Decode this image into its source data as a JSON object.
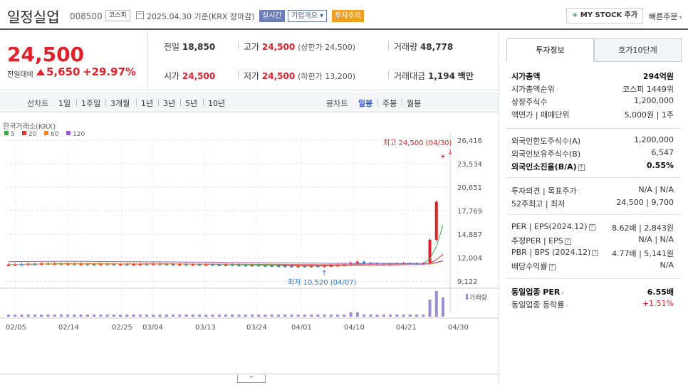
{
  "header": {
    "company": "일정실업",
    "code": "008500",
    "market": "코스피",
    "date_text": "2025.04.30 기준(KRX 장마감)",
    "realtime": "실시간",
    "overview": "기업개요",
    "caution": "투자주의",
    "mystock": "MY STOCK 추가",
    "mystock_plus": "+",
    "quick_order": "빠른주문"
  },
  "price": {
    "current": "24,500",
    "diff_label": "전일대비",
    "diff": "5,650",
    "rate": "+29.97%"
  },
  "quote": {
    "prev_label": "전일",
    "prev": "18,850",
    "high_label": "고가",
    "high": "24,500",
    "high_limit": "(상한가 24,500)",
    "volume_label": "거래량",
    "volume": "48,778",
    "open_label": "시가",
    "open": "24,500",
    "low_label": "저가",
    "low": "24,500",
    "low_limit": "(하한가 13,200)",
    "amount_label": "거래대금",
    "amount": "1,194",
    "amount_unit": "백만"
  },
  "periodbar": {
    "line_label": "선차트",
    "line_items": [
      "1일",
      "1주일",
      "3개월",
      "1년",
      "3년",
      "5년",
      "10년"
    ],
    "candle_label": "봉차트",
    "candle_items": [
      "일봉",
      "주봉",
      "월봉"
    ],
    "candle_active": "일봉"
  },
  "chart": {
    "source": "한국거래소(KRX)",
    "ma": [
      {
        "label": "5",
        "color": "#3aa84a"
      },
      {
        "label": "20",
        "color": "#e03030"
      },
      {
        "label": "60",
        "color": "#f08a20"
      },
      {
        "label": "120",
        "color": "#9a5ad0"
      }
    ],
    "high_note": "최고 24,500 (04/30)",
    "low_note": "최저 10,520 (04/07)",
    "y_ticks": [
      "26,416",
      "23,534",
      "20,651",
      "17,769",
      "14,887",
      "12,004",
      "9,122"
    ],
    "x_ticks": [
      "02/05",
      "02/14",
      "02/25",
      "03/04",
      "03/13",
      "03/24",
      "04/01",
      "04/10",
      "04/21",
      "04/30"
    ],
    "volume_label": "거래량",
    "up_color": "#e0202a",
    "down_color": "#2a7ad7"
  },
  "chart_data": {
    "type": "candlestick",
    "y_range": [
      9122,
      26416
    ],
    "x_ticks": [
      "02/05",
      "02/14",
      "02/25",
      "03/04",
      "03/13",
      "03/24",
      "04/01",
      "04/10",
      "04/21",
      "04/30"
    ],
    "annotations": [
      "최고 24,500 (04/30)",
      "최저 10,520 (04/07)"
    ],
    "close": [
      11150,
      11200,
      11180,
      11250,
      11220,
      11300,
      11260,
      11280,
      11230,
      11270,
      11240,
      11260,
      11220,
      11200,
      11250,
      11230,
      11190,
      11210,
      11180,
      11200,
      11240,
      11220,
      11260,
      11230,
      11210,
      11190,
      11200,
      11170,
      11190,
      11160,
      11180,
      11150,
      11130,
      11160,
      11120,
      11100,
      11080,
      11110,
      11070,
      11050,
      11020,
      11000,
      10980,
      10950,
      10980,
      10960,
      11000,
      10980,
      11020,
      11050,
      11100,
      11150,
      11350,
      11500,
      11300,
      11250,
      11200,
      11180,
      11230,
      11280,
      11320,
      11260,
      11250,
      11300,
      14200,
      18850,
      24500
    ],
    "volume_level": [
      1,
      1,
      1,
      1,
      1,
      1,
      1,
      1,
      1,
      1,
      1,
      1,
      1,
      1,
      1,
      1,
      1,
      1,
      1,
      1,
      1,
      1,
      1,
      1,
      1,
      1,
      1,
      1,
      1,
      1,
      1,
      1,
      1,
      1,
      1,
      1,
      1,
      1,
      1,
      1,
      1,
      1,
      1,
      1,
      1,
      1,
      1,
      1,
      1,
      1,
      1,
      1,
      2,
      2,
      1,
      1,
      1,
      1,
      1,
      1,
      1,
      1,
      1,
      1,
      8,
      12,
      9
    ]
  },
  "panel": {
    "tab_active": "투자정보",
    "tab_inactive": "호가10단계",
    "rows1": [
      {
        "k": "시가총액",
        "v": "294억원",
        "bold": true
      },
      {
        "k": "시가총액순위",
        "v": "코스피 1449위",
        "caret": true
      },
      {
        "k": "상장주식수",
        "v": "1,200,000"
      },
      {
        "k": "액면가 | 매매단위",
        "v": "5,000원 | 1주"
      }
    ],
    "rows2": [
      {
        "k": "외국인한도주식수(A)",
        "v": "1,200,000"
      },
      {
        "k": "외국인보유주식수(B)",
        "v": "6,547"
      },
      {
        "k": "외국인소진율(B/A)",
        "v": "0.55%",
        "bold": true,
        "q": true
      }
    ],
    "rows3": [
      {
        "k": "투자의견 | 목표주가",
        "v": "N/A | N/A"
      },
      {
        "k": "52주최고 | 최저",
        "v": "24,500 | 9,700"
      }
    ],
    "rows4": [
      {
        "k": "PER | EPS(2024.12)",
        "v": "8.62배 | 2,843원",
        "q": true
      },
      {
        "k": "추정PER | EPS",
        "v": "N/A | N/A",
        "q": true
      },
      {
        "k": "PBR | BPS (2024.12)",
        "v": "4.77배 | 5,141원",
        "q": true
      },
      {
        "k": "배당수익률",
        "v": "N/A",
        "q": true
      }
    ],
    "rows5": [
      {
        "k": "동일업종 PER",
        "v": "6.55배",
        "bold": true,
        "caret": true
      },
      {
        "k": "동일업종 등락률",
        "v": "+1.51%",
        "red": true,
        "caret": true
      }
    ]
  },
  "collapse": "^"
}
